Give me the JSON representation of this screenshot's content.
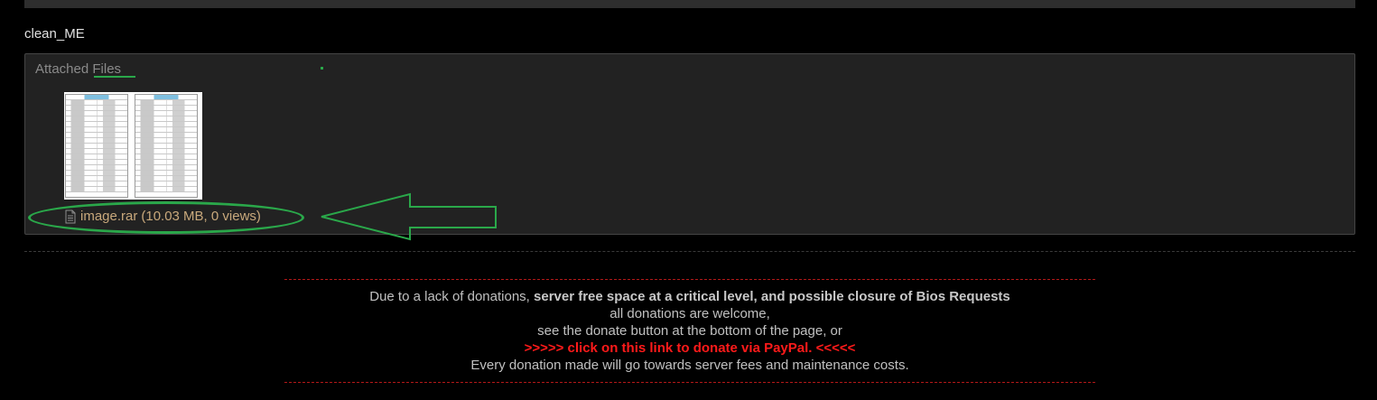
{
  "post": {
    "signature": "clean_ME"
  },
  "attachments": {
    "title": "Attached Files",
    "file": {
      "icon": "file-icon",
      "name": "image.rar",
      "meta": "(10.03 MB, 0 views)"
    }
  },
  "donation": {
    "line1_prefix": "Due to a lack of donations, ",
    "line1_bold": "server free space at a critical level, and possible closure of Bios Requests",
    "line2": "all donations are welcome,",
    "line3": "see the donate button at the bottom of the page, or",
    "paypal_link": ">>>>> click on this link to donate via PayPal. <<<<<",
    "line5": "Every donation made will go towards server fees and maintenance costs."
  },
  "colors": {
    "background": "#000000",
    "panel": "#222222",
    "link": "#c9a97c",
    "annotation": "#2aa84a",
    "alert": "#ff1a1a"
  }
}
